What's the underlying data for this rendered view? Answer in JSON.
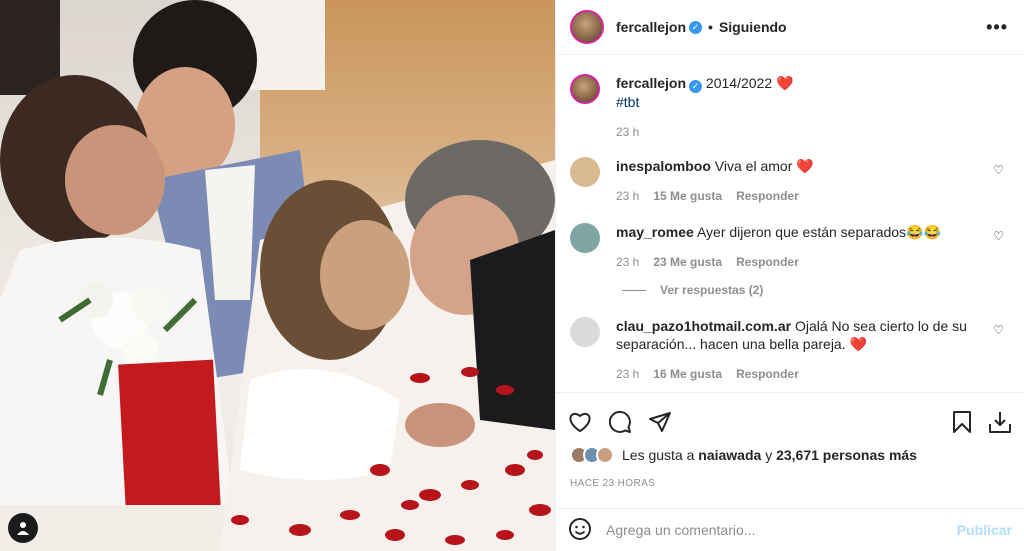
{
  "header": {
    "username": "fercallejon",
    "follow_status": "Siguiendo",
    "more_label": "•••"
  },
  "caption": {
    "username": "fercallejon",
    "text": "2014/2022 ❤️",
    "hashtag": "#tbt",
    "time": "23 h"
  },
  "comments": [
    {
      "username": "inespalomboo",
      "text": "Viva el amor ❤️",
      "time": "23 h",
      "likes": "15 Me gusta",
      "reply": "Responder",
      "avatar_color": "#d9b98f"
    },
    {
      "username": "may_romee",
      "text": "Ayer dijeron que están separados😂😂",
      "time": "23 h",
      "likes": "23 Me gusta",
      "reply": "Responder",
      "view_replies": "Ver respuestas (2)",
      "avatar_color": "#7fa6a4"
    },
    {
      "username": "clau_pazo1hotmail.com.ar",
      "text": "Ojalá No sea cierto lo de su separación... hacen una bella pareja. ❤️",
      "time": "23 h",
      "likes": "16 Me gusta",
      "reply": "Responder",
      "avatar_color": "#dbdbdb"
    }
  ],
  "icons": {
    "like": "heart-icon",
    "comment": "comment-icon",
    "share": "share-icon",
    "save": "bookmark-icon",
    "download": "download-icon",
    "emoji": "emoji-icon",
    "more": "more-icon",
    "user_tag": "user-tag-icon"
  },
  "likes": {
    "prefix": "Les gusta a",
    "user": "naiawada",
    "joiner": "y",
    "others": "23,671 personas más"
  },
  "timestamp": "HACE 23 HORAS",
  "add_comment": {
    "placeholder": "Agrega un comentario...",
    "publish": "Publicar"
  },
  "colors": {
    "link": "#00376b",
    "verified": "#3897f0",
    "publish_disabled": "#b2dffc",
    "meta": "#8e8e8e"
  }
}
